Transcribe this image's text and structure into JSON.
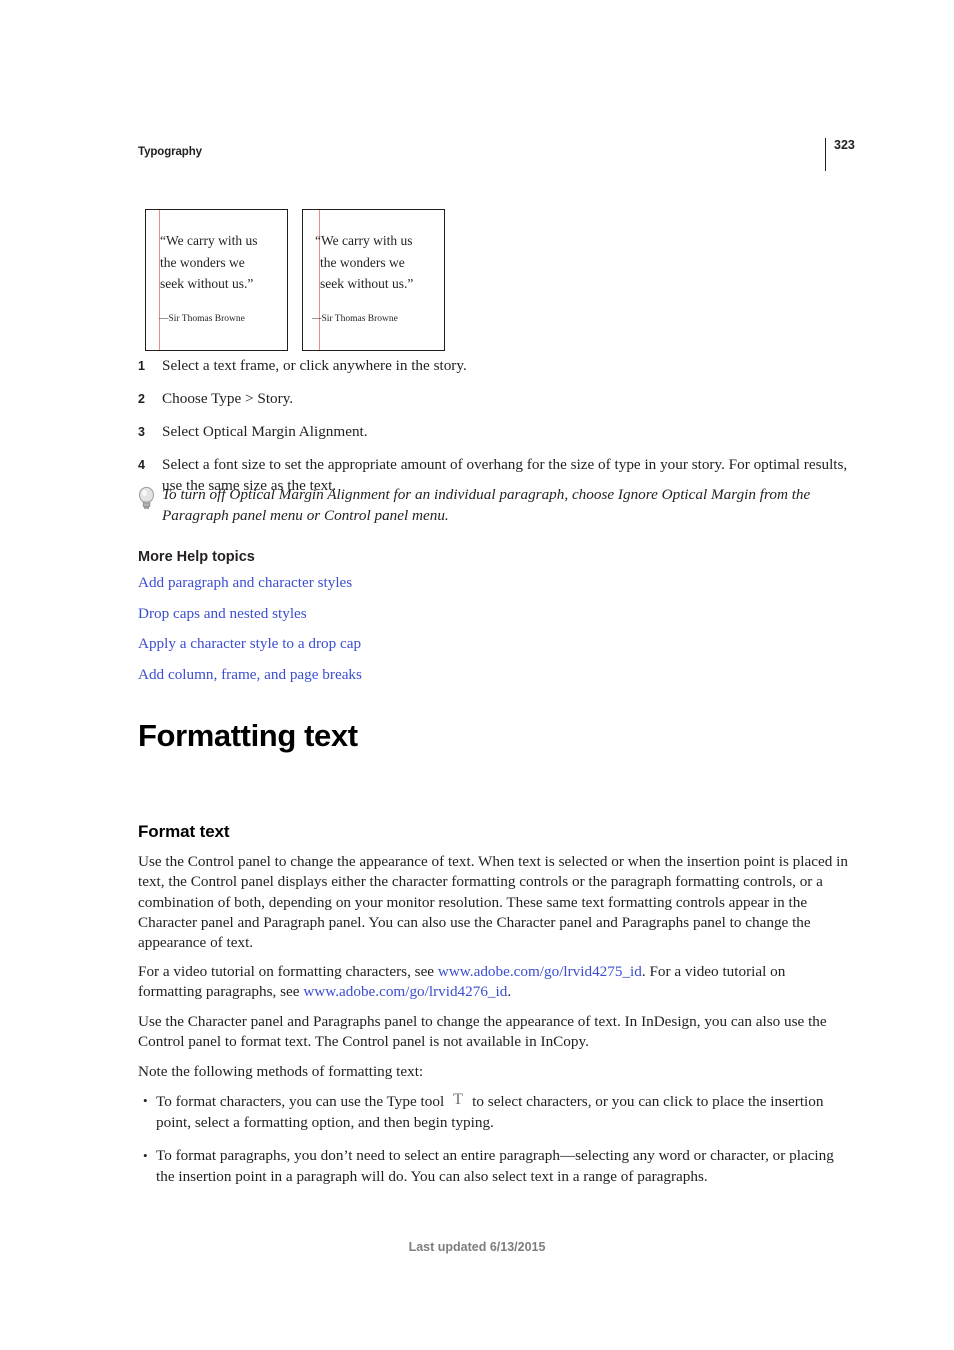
{
  "header": {
    "section_title": "Typography",
    "page_number": "323"
  },
  "figure": {
    "caption_alt": "Optical margin alignment comparison",
    "boxes": [
      {
        "variant": "before",
        "lines": [
          "“We carry with us",
          "the wonders we",
          "seek without us.”"
        ],
        "attribution": "—Sir Thomas Browne",
        "margin_color": "#e98d8d"
      },
      {
        "variant": "after",
        "lines": [
          "“We carry with us",
          "the wonders we",
          "seek without us.”"
        ],
        "attribution": "—Sir Thomas Browne",
        "margin_color": "#e98d8d"
      }
    ]
  },
  "steps": [
    {
      "num": "1",
      "text": "Select a text frame, or click anywhere in the story."
    },
    {
      "num": "2",
      "text": "Choose Type > Story."
    },
    {
      "num": "3",
      "text": "Select Optical Margin Alignment."
    },
    {
      "num": "4",
      "text": "Select a font size to set the appropriate amount of overhang for the size of type in your story. For optimal results, use the same size as the text."
    }
  ],
  "tip": {
    "icon": "lightbulb-icon",
    "text": "To turn off Optical Margin Alignment for an individual paragraph, choose Ignore Optical Margin from the Paragraph panel menu or Control panel menu."
  },
  "more_help": {
    "title": "More Help topics",
    "link_color": "#3b4ed0",
    "links": [
      "Add paragraph and character styles",
      "Drop caps and nested styles",
      "Apply a character style to a drop cap",
      "Add column, frame, and page breaks"
    ]
  },
  "headings": {
    "h1": "Formatting text",
    "h2": "Format text"
  },
  "paragraphs": {
    "p1": "Use the Control panel to change the appearance of text. When text is selected or when the insertion point is placed in text, the Control panel displays either the character formatting controls or the paragraph formatting controls, or a combination of both, depending on your monitor resolution. These same text formatting controls appear in the Character panel and Paragraph panel. You can also use the Character panel and Paragraphs panel to change the appearance of text.",
    "p2_part1": "For a video tutorial on formatting characters, see ",
    "p2_link1": "www.adobe.com/go/lrvid4275_id",
    "p2_part2": ". For a video tutorial on formatting paragraphs, see ",
    "p2_link2": "www.adobe.com/go/lrvid4276_id",
    "p2_part3": ".",
    "p3": "Use the Character panel and Paragraphs panel to change the appearance of text. In InDesign, you can also use the Control panel to format text. The Control panel is not available in InCopy.",
    "p4": "Note the following methods of formatting text:"
  },
  "bullets": {
    "marker": "•",
    "items": [
      {
        "text_before_icon": "To format characters, you can use the Type tool",
        "icon": "type-tool-icon",
        "text_after_icon": "to select characters, or you can click to place the insertion point, select a formatting option, and then begin typing."
      },
      {
        "text_before_icon": "To format paragraphs, you don’t need to select an entire paragraph—selecting any word or character, or placing the insertion point in a paragraph will do. You can also select text in a range of paragraphs.",
        "icon": "",
        "text_after_icon": ""
      }
    ]
  },
  "footer": {
    "text": "Last updated 6/13/2015"
  }
}
